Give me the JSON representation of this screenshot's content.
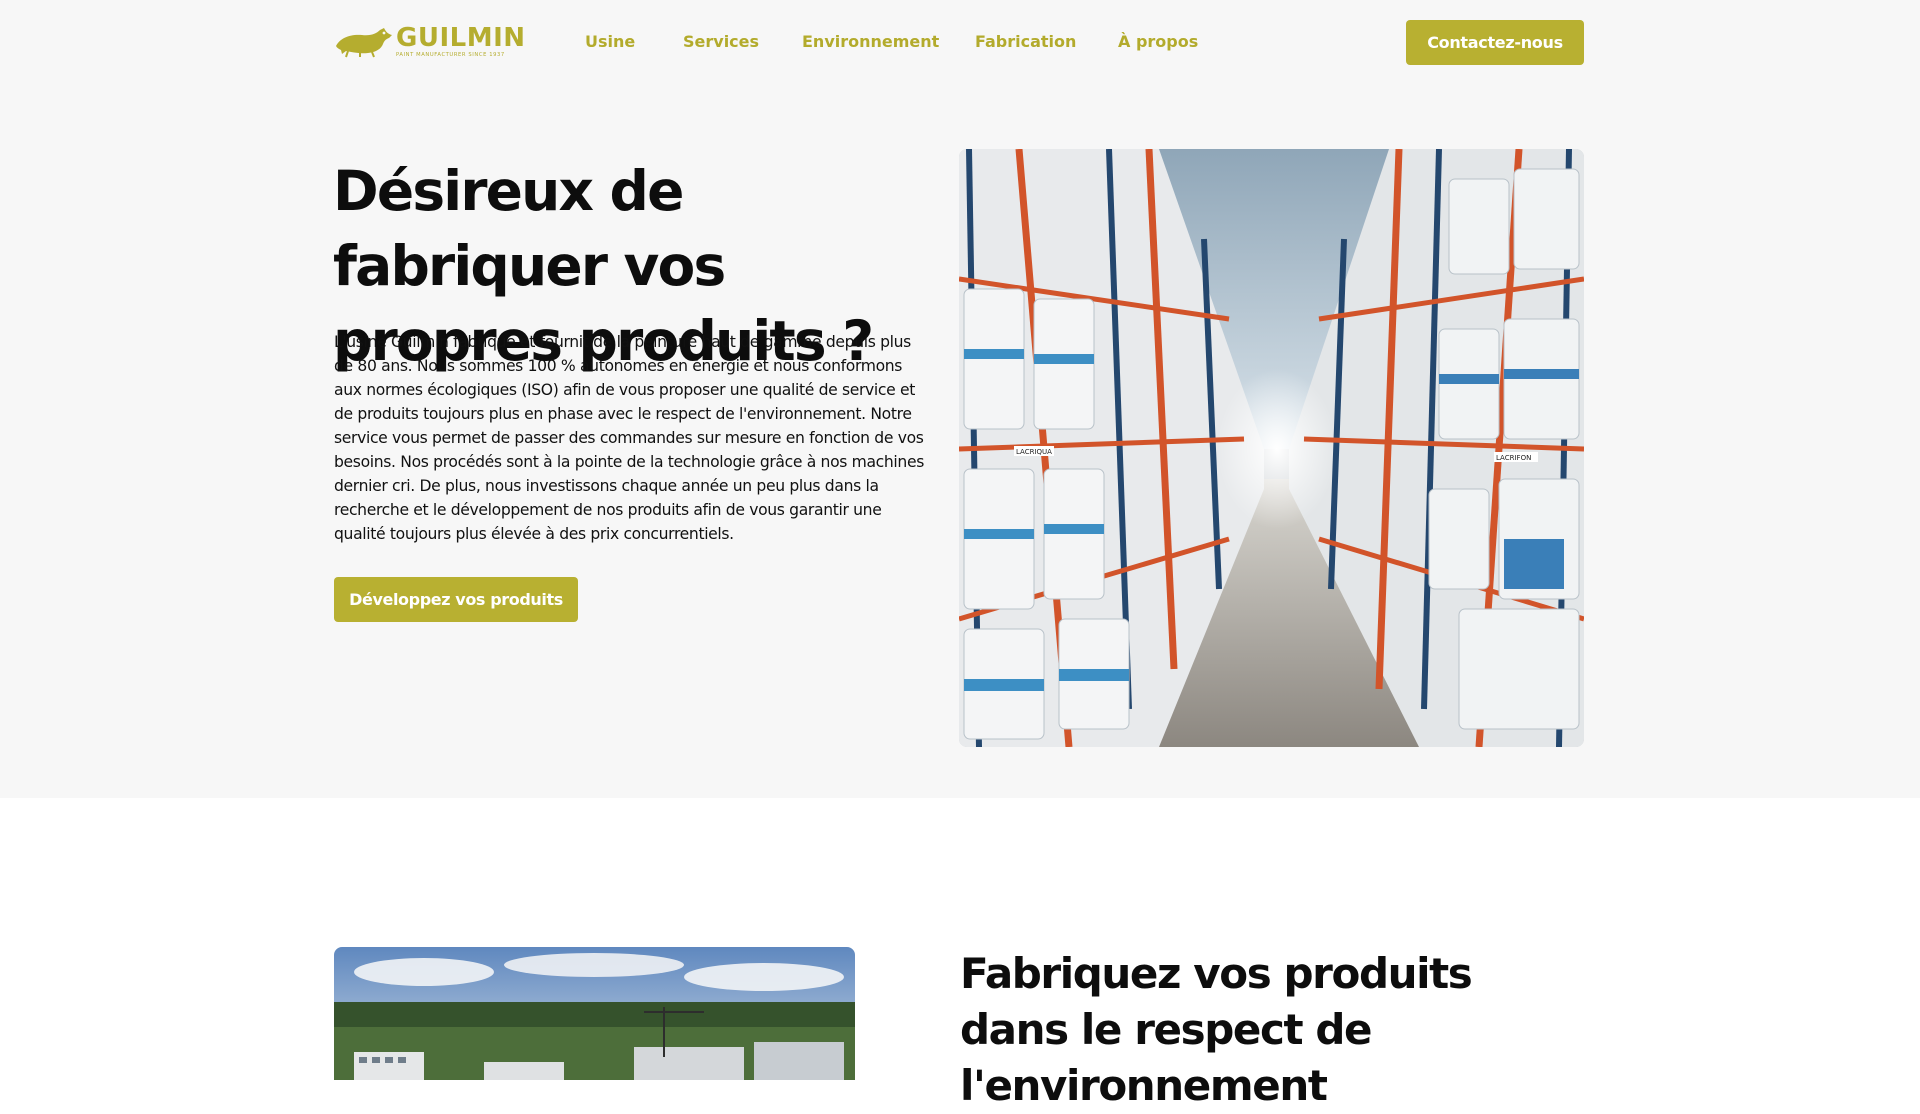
{
  "brand": {
    "name": "GUILMIN",
    "tagline": "PAINT MANUFACTURER SINCE 1937",
    "accent_color": "#b8b031"
  },
  "nav": {
    "items": [
      {
        "label": "Usine"
      },
      {
        "label": "Services"
      },
      {
        "label": "Environnement"
      },
      {
        "label": "Fabrication"
      },
      {
        "label": "À propos"
      }
    ],
    "cta_label": "Contactez-nous"
  },
  "hero": {
    "title": "Désireux de fabriquer vos propres produits ?",
    "body": "L'usine Guilmin fabrique et fournit de la peinture haut de gamme depuis plus de 80 ans. Nous sommes 100 % autonomes en énergie et nous conformons aux normes écologiques (ISO) afin de vous proposer une qualité de service et de produits toujours plus en phase avec le respect de l'environnement. Notre service vous permet de passer des commandes sur mesure en fonction de vos besoins. Nos procédés sont à la pointe de la technologie grâce à nos machines dernier cri. De plus, nous investissons chaque année un peu plus dans la recherche et le développement de nos produits afin de vous garantir une qualité toujours plus élevée à des prix concurrentiels.",
    "button_label": "Développez vos produits",
    "image_labels": [
      "LACRIQUA",
      "LACRIFON"
    ]
  },
  "section2": {
    "title": "Fabriquez vos produits dans le respect de l'environnement"
  }
}
